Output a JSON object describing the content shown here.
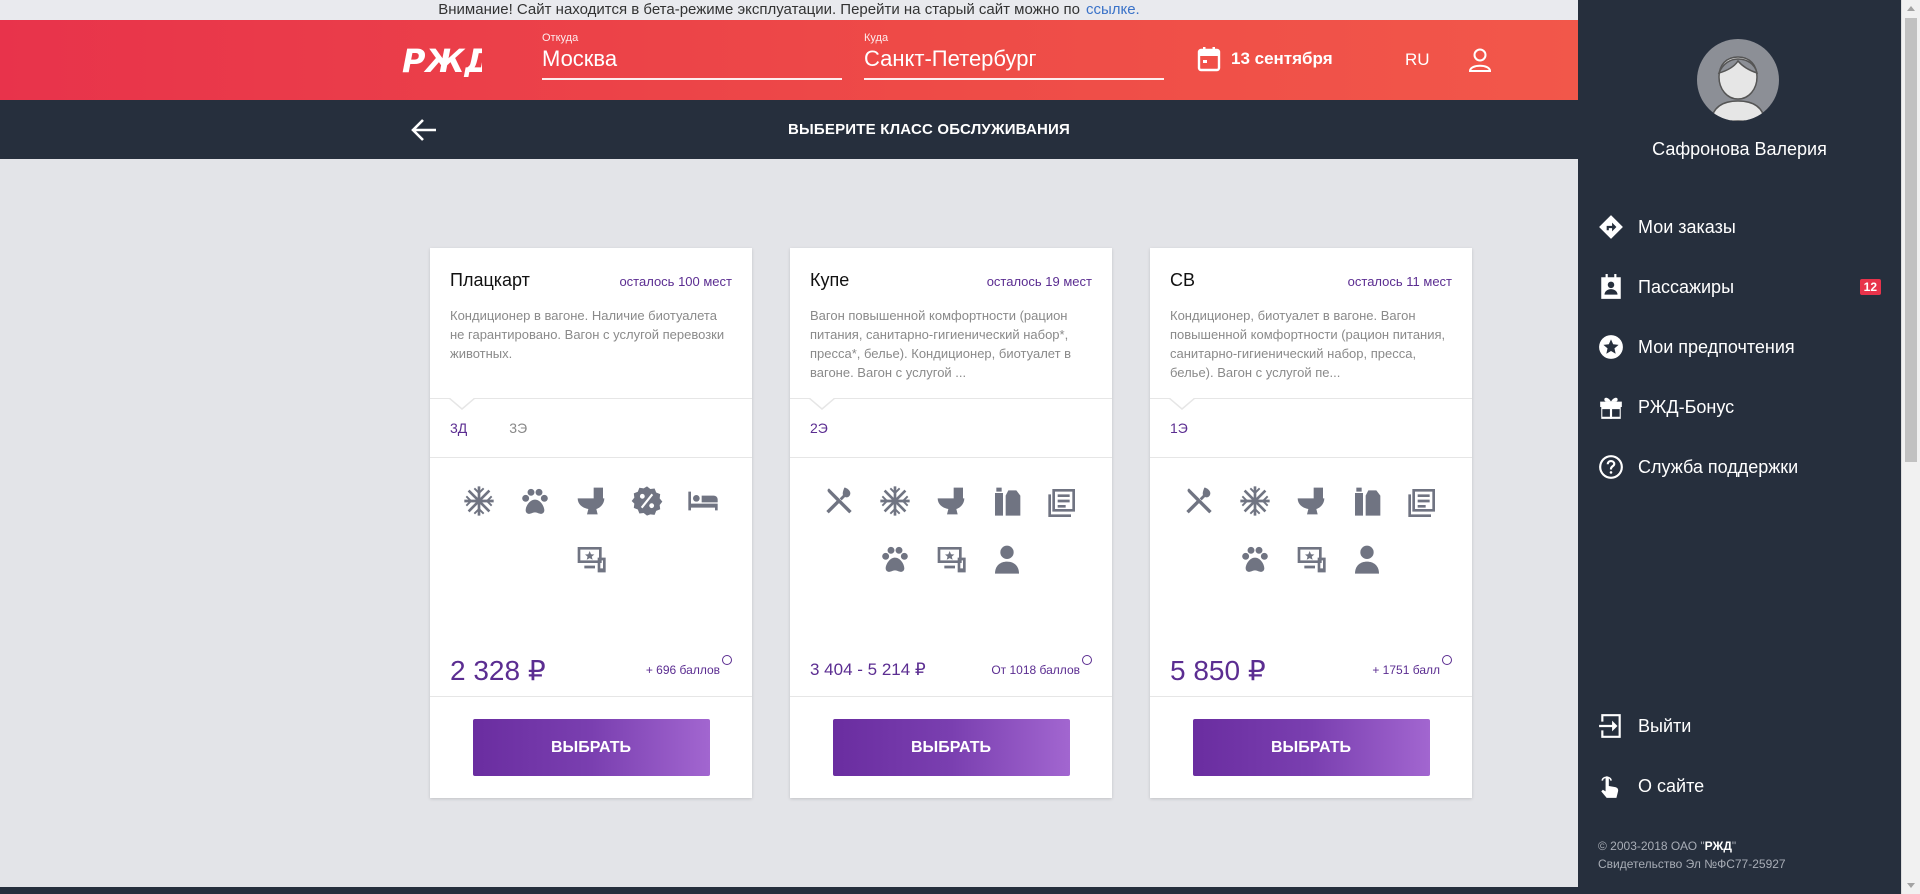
{
  "banner": {
    "text": "Внимание! Сайт находится в бета-режиме эксплуатации. Перейти на старый сайт можно по",
    "link": "ссылке."
  },
  "header": {
    "logo_text": "РЖД",
    "from_label": "Откуда",
    "from_value": "Москва",
    "to_label": "Куда",
    "to_value": "Санкт-Петербург",
    "date": "13 сентября",
    "lang": "RU"
  },
  "subbar": {
    "title": "ВЫБЕРИТЕ КЛАСС ОБСЛУЖИВАНИЯ"
  },
  "cards": [
    {
      "name": "Плацкарт",
      "seats_left": "осталось 100 мест",
      "desc": "Кондиционер в вагоне. Наличие биотуалета не гарантировано. Вагон с услугой перевозки животных.",
      "tabs": [
        "3Д",
        "3Э"
      ],
      "icons": [
        "snowflake-icon",
        "paw-icon",
        "toilet-icon",
        "discount-icon",
        "bed-icon",
        "media-icon"
      ],
      "price": "2 328 ₽",
      "points": "+ 696 баллов",
      "button": "ВЫБРАТЬ"
    },
    {
      "name": "Купе",
      "seats_left": "осталось 19 мест",
      "desc": "Вагон повышенной комфортности (рацион питания, санитарно-гигиенический набор*, пресса*, белье). Кондиционер, биотуалет в вагоне. Вагон с услугой ...",
      "tabs": [
        "2Э"
      ],
      "icons": [
        "cutlery-icon",
        "snowflake-icon",
        "toilet-icon",
        "hygiene-kit-icon",
        "newspaper-icon",
        "paw-icon",
        "media-icon",
        "person-icon"
      ],
      "price": "3 404 - 5 214 ₽",
      "points": "От 1018 баллов",
      "button": "ВЫБРАТЬ"
    },
    {
      "name": "СВ",
      "seats_left": "осталось 11 мест",
      "desc": "Кондиционер, биотуалет в вагоне. Вагон повышенной комфортности (рацион питания, санитарно-гигиенический набор, пресса, белье). Вагон с услугой пе...",
      "tabs": [
        "1Э"
      ],
      "icons": [
        "cutlery-icon",
        "snowflake-icon",
        "toilet-icon",
        "hygiene-kit-icon",
        "newspaper-icon",
        "paw-icon",
        "media-icon",
        "person-icon"
      ],
      "price": "5 850 ₽",
      "points": "+ 1751 балл",
      "button": "ВЫБРАТЬ"
    }
  ],
  "panel": {
    "user_name": "Сафронова Валерия",
    "menu": [
      {
        "label": "Мои заказы",
        "icon": "directions-icon"
      },
      {
        "label": "Пассажиры",
        "icon": "contacts-icon",
        "badge": "12"
      },
      {
        "label": "Мои предпочтения",
        "icon": "star-icon"
      },
      {
        "label": "РЖД-Бонус",
        "icon": "gift-icon"
      },
      {
        "label": "Служба поддержки",
        "icon": "help-icon"
      }
    ],
    "menu_bottom": [
      {
        "label": "Выйти",
        "icon": "logout-icon"
      },
      {
        "label": "О сайте",
        "icon": "touch-icon"
      }
    ],
    "copyright_prefix": "© 2003-2018 ОАО \"",
    "copyright_brand": "РЖД",
    "copyright_suffix": "\"",
    "license": "Свидетельство Эл №ФС77-25927"
  },
  "colors": {
    "header_red": "#e8334b",
    "dark": "#262f3d",
    "accent_purple": "#5b2d91",
    "badge_red": "#e8334b"
  }
}
